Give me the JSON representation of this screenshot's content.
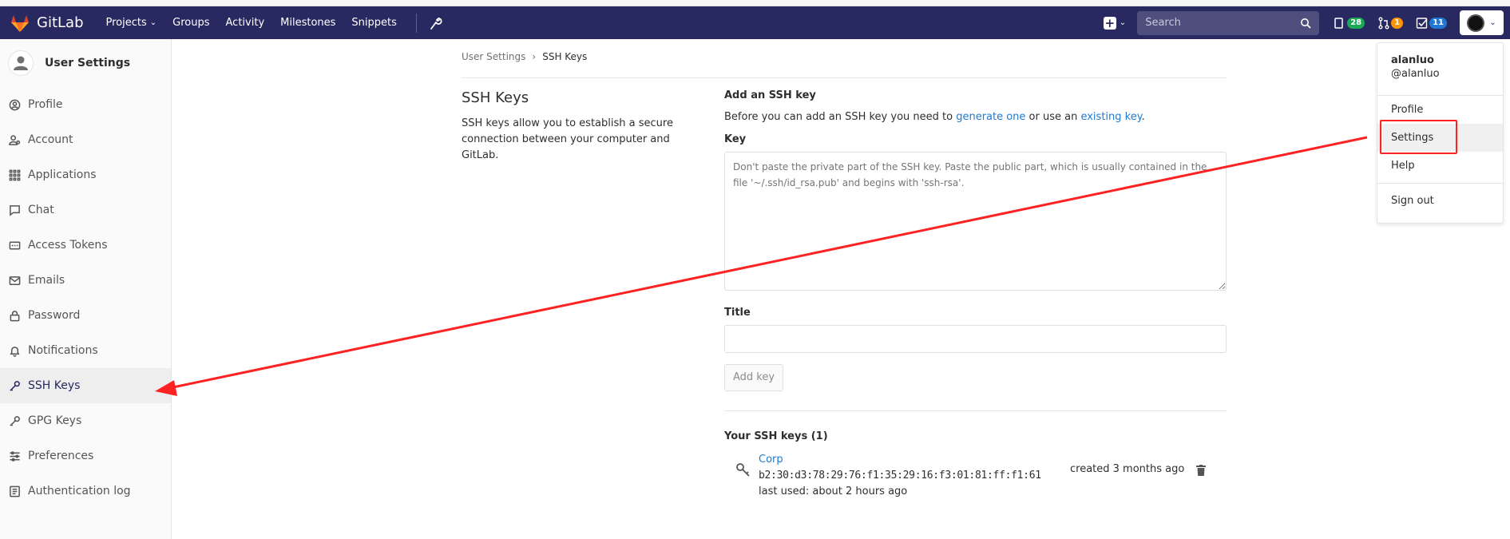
{
  "navbar": {
    "brand": "GitLab",
    "links": [
      {
        "label": "Projects",
        "has_caret": true
      },
      {
        "label": "Groups"
      },
      {
        "label": "Activity"
      },
      {
        "label": "Milestones"
      },
      {
        "label": "Snippets"
      }
    ],
    "search_placeholder": "Search",
    "counters": {
      "mr_todo": "28",
      "merge_requests": "1",
      "todos": "11"
    },
    "colors": {
      "bg": "#292961",
      "green": "#1aaa55",
      "orange": "#fc9403",
      "blue": "#1f78d1"
    }
  },
  "sidebar": {
    "title": "User Settings",
    "items": [
      {
        "label": "Profile",
        "icon": "profile-icon"
      },
      {
        "label": "Account",
        "icon": "account-icon"
      },
      {
        "label": "Applications",
        "icon": "applications-icon"
      },
      {
        "label": "Chat",
        "icon": "chat-icon"
      },
      {
        "label": "Access Tokens",
        "icon": "token-icon"
      },
      {
        "label": "Emails",
        "icon": "email-icon"
      },
      {
        "label": "Password",
        "icon": "lock-icon"
      },
      {
        "label": "Notifications",
        "icon": "bell-icon"
      },
      {
        "label": "SSH Keys",
        "icon": "key-icon",
        "active": true
      },
      {
        "label": "GPG Keys",
        "icon": "key-icon"
      },
      {
        "label": "Preferences",
        "icon": "preferences-icon"
      },
      {
        "label": "Authentication log",
        "icon": "log-icon"
      }
    ]
  },
  "breadcrumb": {
    "parent": "User Settings",
    "current": "SSH Keys"
  },
  "section": {
    "title": "SSH Keys",
    "description": "SSH keys allow you to establish a secure connection between your computer and GitLab."
  },
  "form": {
    "heading": "Add an SSH key",
    "intro_before": "Before you can add an SSH key you need to ",
    "intro_link1": "generate one",
    "intro_middle": " or use an ",
    "intro_link2": "existing key",
    "intro_after": ".",
    "key_label": "Key",
    "key_placeholder": "Don't paste the private part of the SSH key. Paste the public part, which is usually contained in the file '~/.ssh/id_rsa.pub' and begins with 'ssh-rsa'.",
    "title_label": "Title",
    "title_value": "",
    "submit_label": "Add key"
  },
  "keys": {
    "heading": "Your SSH keys (1)",
    "items": [
      {
        "name": "Corp",
        "fingerprint": "b2:30:d3:78:29:76:f1:35:29:16:f3:01:81:ff:f1:61",
        "last_used": "last used: about 2 hours ago",
        "created": "created 3 months ago"
      }
    ]
  },
  "dropdown": {
    "name": "alanluo",
    "handle": "@alanluo",
    "items": [
      "Profile",
      "Settings",
      "Help"
    ],
    "signout": "Sign out",
    "highlighted": "Settings"
  },
  "annotation": {
    "color": "#ff2222"
  }
}
